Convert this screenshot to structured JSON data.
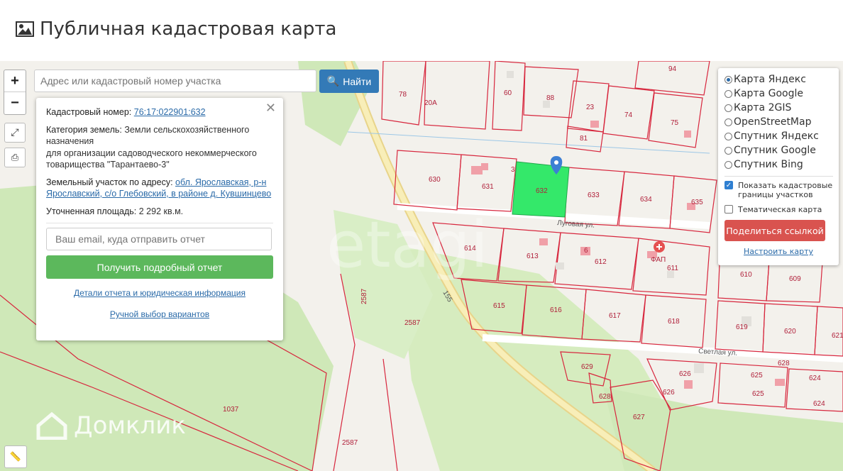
{
  "header": {
    "title": "Публичная кадастровая карта",
    "icon": "image-icon"
  },
  "search": {
    "placeholder": "Адрес или кадастровый номер участка",
    "button_label": "Найти"
  },
  "zoom": {
    "plus": "+",
    "minus": "−"
  },
  "popup": {
    "cadastral_label": "Кадастровый номер:",
    "cadastral_number": "76:17:022901:632",
    "category_label": "Категория земель:",
    "category_value": "Земли сельскохозяйственного назначения",
    "category_purpose": "для организации садоводческого некоммерческого товарищества \"Тарантаево-3\"",
    "address_label": "Земельный участок по адресу:",
    "address_value": "обл. Ярославская, р-н Ярославский, с/о Глебовский, в районе д. Кувшинцево",
    "area_label": "Уточненная площадь:",
    "area_value": "2 292 кв.м.",
    "email_placeholder": "Ваш email, куда отправить отчет",
    "report_button": "Получить подробный отчет",
    "details_link": "Детали отчета и юридическая информация",
    "manual_link": "Ручной выбор вариантов"
  },
  "layers": {
    "options": [
      {
        "label": "Карта Яндекс",
        "selected": true
      },
      {
        "label": "Карта Google",
        "selected": false
      },
      {
        "label": "Карта 2GIS",
        "selected": false
      },
      {
        "label": "OpenStreetMap",
        "selected": false
      },
      {
        "label": "Спутник Яндекс",
        "selected": false
      },
      {
        "label": "Спутник Google",
        "selected": false
      },
      {
        "label": "Спутник Bing",
        "selected": false
      }
    ],
    "show_boundaries": "Показать кадастровые границы участков",
    "show_boundaries_checked": true,
    "thematic": "Тематическая карта",
    "thematic_checked": false,
    "share_button": "Поделиться ссылкой",
    "configure_link": "Настроить карту"
  },
  "map": {
    "parcel_labels": [
      "78",
      "60",
      "88",
      "23",
      "74",
      "75",
      "94",
      "81",
      "20А",
      "630",
      "631",
      "3",
      "632",
      "633",
      "634",
      "635",
      "614",
      "613",
      "6",
      "612",
      "ФАП",
      "611",
      "615",
      "616",
      "617",
      "618",
      "610",
      "609",
      "619",
      "620",
      "621",
      "629",
      "628",
      "626",
      "625",
      "624",
      "628",
      "626",
      "625",
      "624",
      "627",
      "1037",
      "2587",
      "2587",
      "2587",
      "155"
    ],
    "streets": [
      "Луговая ул.",
      "Светлая ул."
    ],
    "watermark": "Домклик",
    "colors": {
      "selected_parcel": "#34e86a",
      "boundary": "#d7263d",
      "road": "#f5e7a4",
      "greenery": "#cdeab5"
    }
  }
}
